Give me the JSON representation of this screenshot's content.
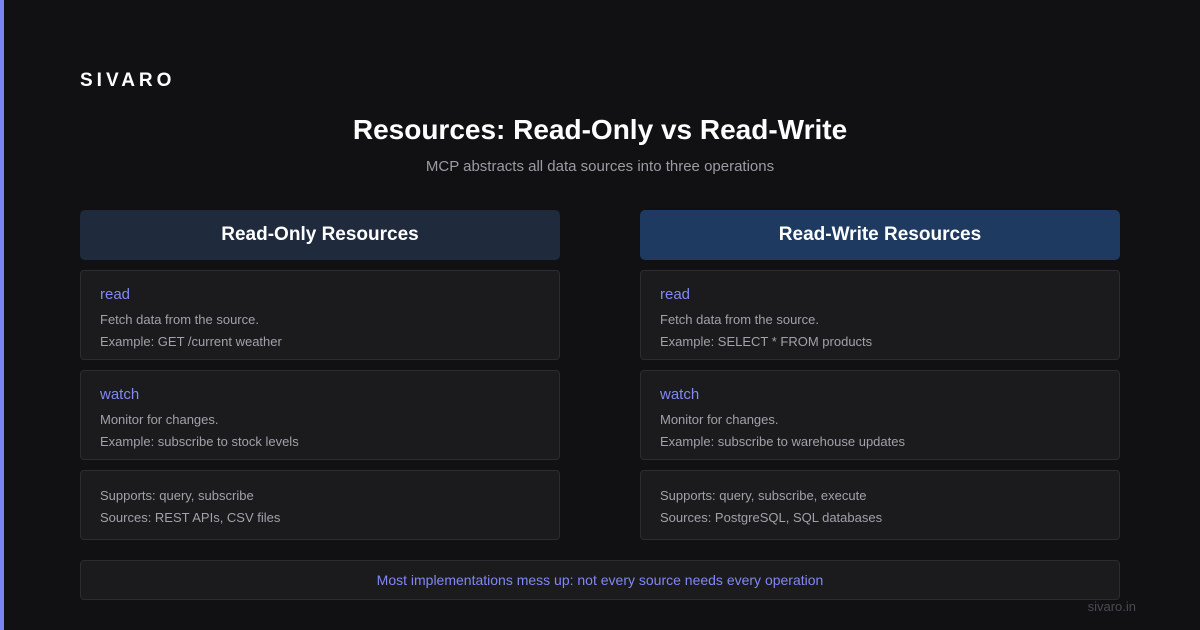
{
  "brand": "SIVARO",
  "title": "Resources: Read-Only vs Read-Write",
  "subtitle": "MCP abstracts all data sources into three operations",
  "columns": {
    "left": {
      "header": "Read-Only Resources",
      "read": {
        "name": "read",
        "description": "Fetch data from the source.",
        "example": "Example: GET /current weather"
      },
      "watch": {
        "name": "watch",
        "description": "Monitor for changes.",
        "example": "Example: subscribe to stock levels"
      },
      "info": {
        "supports": "Supports: query, subscribe",
        "sources": "Sources: REST APIs, CSV files"
      }
    },
    "right": {
      "header": "Read-Write Resources",
      "read": {
        "name": "read",
        "description": "Fetch data from the source.",
        "example": "Example: SELECT * FROM products"
      },
      "watch": {
        "name": "watch",
        "description": "Monitor for changes.",
        "example": "Example: subscribe to warehouse updates"
      },
      "info": {
        "supports": "Supports: query, subscribe, execute",
        "sources": "Sources: PostgreSQL, SQL databases"
      }
    }
  },
  "footer": "Most implementations mess up: not every source needs every operation",
  "site": "sivaro.in",
  "colors": {
    "accent": "#7c83f2",
    "operation_text": "#8088f2",
    "background": "#111113",
    "left_header": "#1f2a3d",
    "right_header": "#1e3a60"
  }
}
